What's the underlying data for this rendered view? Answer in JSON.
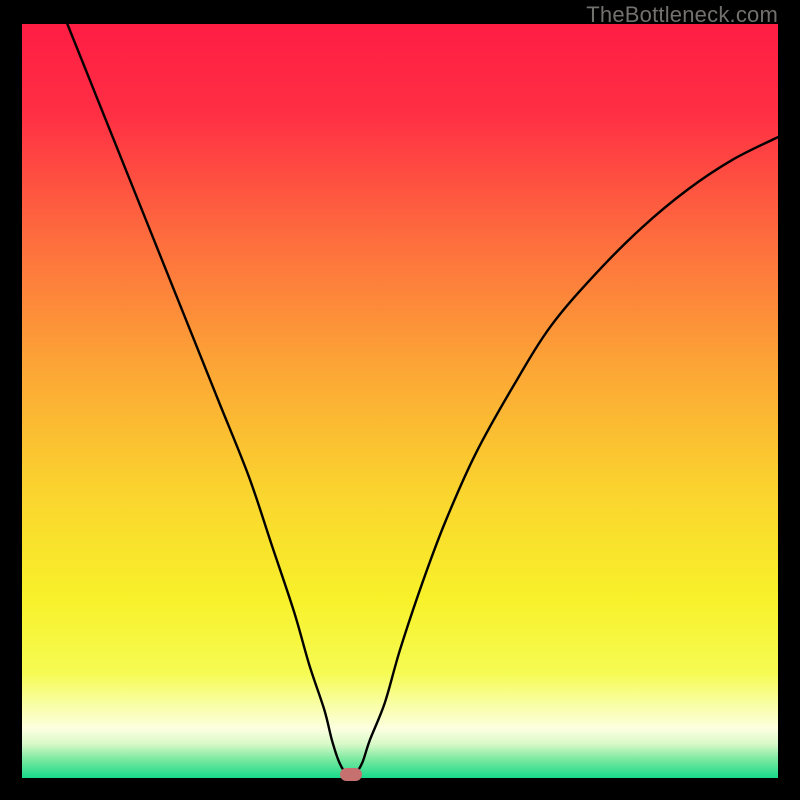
{
  "watermark": "TheBottleneck.com",
  "chart_data": {
    "type": "line",
    "title": "",
    "xlabel": "",
    "ylabel": "",
    "xlim": [
      0,
      100
    ],
    "ylim": [
      0,
      100
    ],
    "series": [
      {
        "name": "bottleneck-curve",
        "x": [
          6,
          10,
          14,
          18,
          22,
          26,
          30,
          33,
          36,
          38,
          40,
          41,
          42,
          43,
          44,
          45,
          46,
          48,
          50,
          53,
          56,
          60,
          65,
          70,
          76,
          82,
          88,
          94,
          100
        ],
        "y": [
          100,
          90,
          80,
          70,
          60,
          50,
          40,
          31,
          22,
          15,
          9,
          5,
          2,
          0.5,
          0.5,
          2,
          5,
          10,
          17,
          26,
          34,
          43,
          52,
          60,
          67,
          73,
          78,
          82,
          85
        ]
      }
    ],
    "marker": {
      "x": 43.5,
      "y": 0.5
    },
    "gradient_stops": [
      {
        "offset": 0.0,
        "color": "#ff1d44"
      },
      {
        "offset": 0.12,
        "color": "#ff2f44"
      },
      {
        "offset": 0.28,
        "color": "#fe6b3e"
      },
      {
        "offset": 0.45,
        "color": "#fca436"
      },
      {
        "offset": 0.62,
        "color": "#fad42e"
      },
      {
        "offset": 0.76,
        "color": "#f8f12a"
      },
      {
        "offset": 0.86,
        "color": "#f6fb52"
      },
      {
        "offset": 0.9,
        "color": "#f8fea0"
      },
      {
        "offset": 0.935,
        "color": "#fcffe0"
      },
      {
        "offset": 0.955,
        "color": "#d8f9c8"
      },
      {
        "offset": 0.975,
        "color": "#7be9a0"
      },
      {
        "offset": 1.0,
        "color": "#18da8a"
      }
    ]
  }
}
